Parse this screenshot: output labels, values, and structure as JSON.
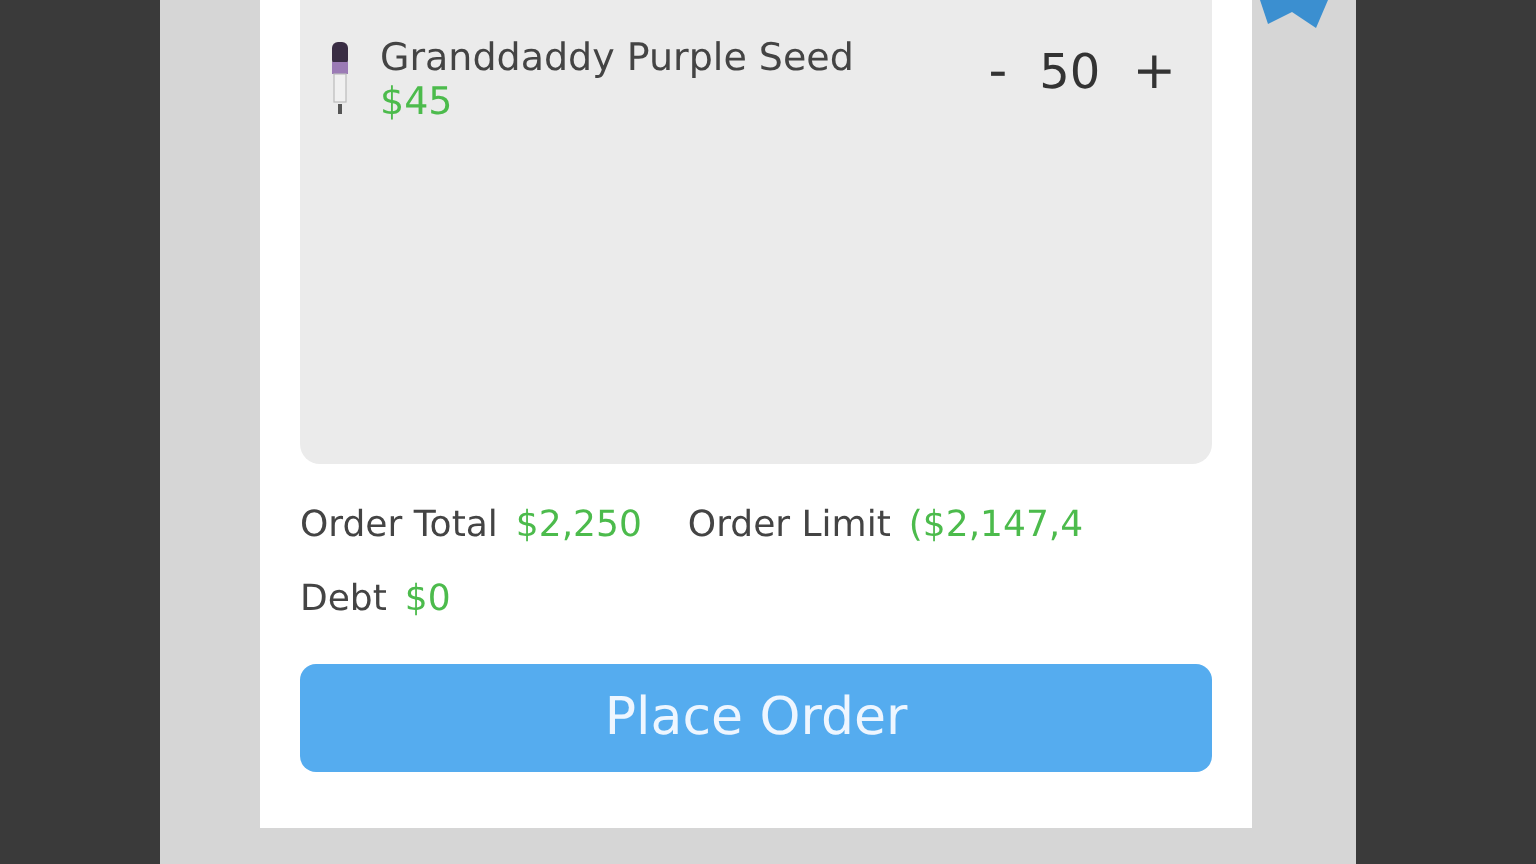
{
  "cart_items": [
    {
      "name": "Granddaddy Purple Seed",
      "price": "$45",
      "quantity": "50",
      "decrement": "-",
      "increment": "+"
    }
  ],
  "summary": {
    "total_label": "Order Total",
    "total_value": "$2,250",
    "limit_label": "Order Limit",
    "limit_value": "($2,147,4",
    "debt_label": "Debt",
    "debt_value": "$0"
  },
  "place_order_button": "Place Order"
}
